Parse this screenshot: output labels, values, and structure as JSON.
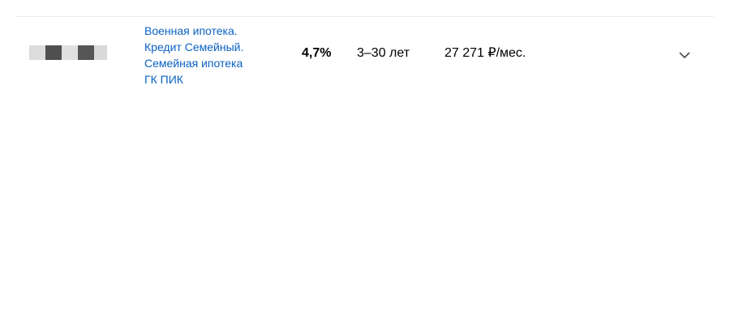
{
  "offer": {
    "product_lines": "Военная ипотека.\nКредит Семейный.\nСемейная ипотека\nГК ПИК",
    "rate": "4,7%",
    "term": "3–30 лет",
    "monthly_payment": "27 271 ₽/мес."
  },
  "icons": {
    "bank_logo": "bank-logo-pixelated",
    "expand": "chevron-down-icon"
  },
  "colors": {
    "link": "#0a61c2",
    "text": "#000000",
    "divider": "#ebebeb",
    "chevron": "#555555"
  }
}
